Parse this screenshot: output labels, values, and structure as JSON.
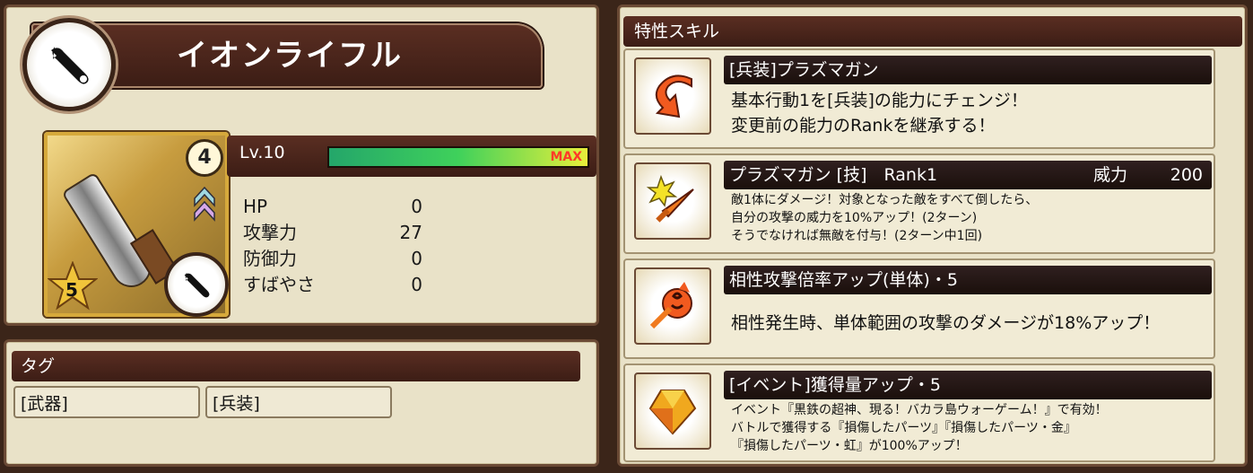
{
  "item": {
    "name": "イオンライフル",
    "slot_number": "4",
    "rarity": "5",
    "level_label": "Lv.10",
    "level_progress": 1.0,
    "level_max_label": "MAX",
    "stats": [
      {
        "label": "HP",
        "value": "0"
      },
      {
        "label": "攻撃力",
        "value": "27"
      },
      {
        "label": "防御力",
        "value": "0"
      },
      {
        "label": "すばやさ",
        "value": "0"
      }
    ]
  },
  "tags": {
    "header": "タグ",
    "items": [
      "[武器]",
      "[兵装]"
    ]
  },
  "skills": {
    "header": "特性スキル",
    "list": [
      {
        "icon": "change-arrow-icon",
        "title": "[兵装]プラズマガン",
        "desc": [
          "基本行動1を[兵装]の能力にチェンジ！",
          "変更前の能力のRankを継承する！"
        ]
      },
      {
        "icon": "sword-burst-icon",
        "title": "プラズマガン [技]　Rank1",
        "power_label": "威力",
        "power_value": "200",
        "desc": [
          "敵1体にダメージ！対象となった敵をすべて倒したら、",
          "自分の攻撃の威力を10%アップ！(2ターン)",
          "そうでなければ無敵を付与！(2ターン中1回)"
        ]
      },
      {
        "icon": "affinity-attack-icon",
        "title": "相性攻撃倍率アップ(単体)・5",
        "desc": [
          "相性発生時、単体範囲の攻撃のダメージが18%アップ！"
        ]
      },
      {
        "icon": "gem-acquire-icon",
        "title": "[イベント]獲得量アップ・5",
        "desc": [
          "イベント『黒鉄の超神、現る！バカラ島ウォーゲーム！』で有効！",
          "バトルで獲得する『損傷したパーツ』『損傷したパーツ・金』",
          "『損傷したパーツ・虹』が100%アップ！"
        ]
      }
    ]
  },
  "colors": {
    "panel_bg": "#e9e2c8",
    "header_bg": "#4a261c",
    "gauge_start": "#24a66a",
    "gauge_end": "#e8ef3a",
    "max_text": "#ff3a28"
  }
}
